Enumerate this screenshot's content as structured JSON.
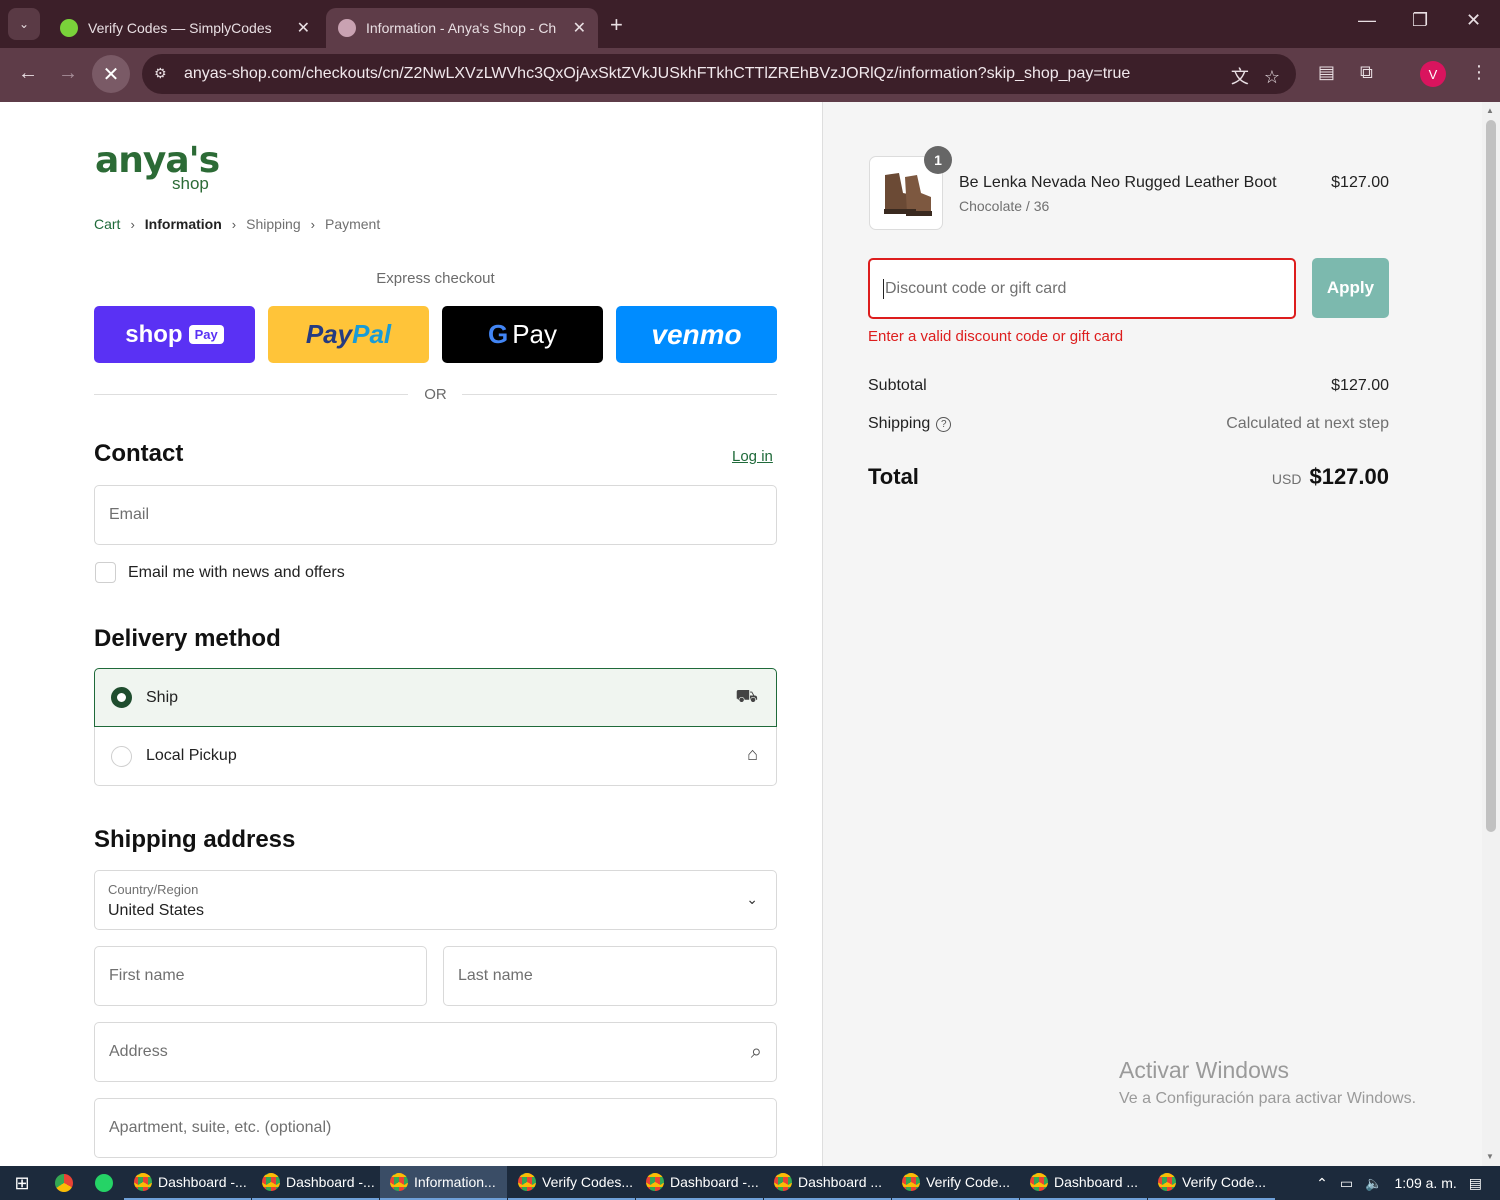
{
  "browser": {
    "tabs": [
      {
        "title": "Verify Codes — SimplyCodes",
        "favicon_color": "#7ad23a"
      },
      {
        "title": "Information - Anya's Shop - Ch",
        "favicon_color": "#c9a2b2"
      }
    ],
    "url": "anyas-shop.com/checkouts/cn/Z2NwLXVzLWVhc3QxOjAxSktZVkJUSkhFTkhCTTlZREhBVzJORlQz/information?skip_shop_pay=true",
    "avatar_letter": "V",
    "theme_color": "#5e3c48"
  },
  "shop": {
    "logo_main": "anya's",
    "logo_sub": "shop",
    "brand_color": "#2c6b36"
  },
  "breadcrumb": [
    "Cart",
    "Information",
    "Shipping",
    "Payment"
  ],
  "express": {
    "label": "Express checkout",
    "shop_pay": "shop",
    "shop_pay_pill": "Pay",
    "paypal_a": "Pay",
    "paypal_b": "Pal",
    "gpay_g": "G",
    "gpay": "Pay",
    "venmo": "venmo",
    "or": "OR"
  },
  "contact": {
    "heading": "Contact",
    "login": "Log in",
    "email_placeholder": "Email",
    "newsletter": "Email me with news and offers"
  },
  "delivery": {
    "heading": "Delivery method",
    "options": [
      {
        "label": "Ship",
        "selected": true
      },
      {
        "label": "Local Pickup",
        "selected": false
      }
    ]
  },
  "shipping": {
    "heading": "Shipping address",
    "country_label": "Country/Region",
    "country": "United States",
    "first_name": "First name",
    "last_name": "Last name",
    "address": "Address",
    "apartment": "Apartment, suite, etc. (optional)"
  },
  "summary": {
    "product": {
      "name": "Be Lenka Nevada Neo Rugged Leather Boot",
      "variant": "Chocolate / 36",
      "price": "$127.00",
      "quantity": "1"
    },
    "discount_placeholder": "Discount code or gift card",
    "apply": "Apply",
    "error": "Enter a valid discount code or gift card",
    "subtotal_label": "Subtotal",
    "subtotal": "$127.00",
    "shipping_label": "Shipping",
    "shipping_value": "Calculated at next step",
    "total_label": "Total",
    "currency": "USD",
    "total": "$127.00"
  },
  "watermark": {
    "line1": "Activar Windows",
    "line2": "Ve a Configuración para activar Windows."
  },
  "taskbar": {
    "items": [
      {
        "label": "Dashboard -...",
        "active": false
      },
      {
        "label": "Dashboard -...",
        "active": false
      },
      {
        "label": "Information...",
        "active": true
      },
      {
        "label": "Verify Codes...",
        "active": false
      },
      {
        "label": "Dashboard -...",
        "active": false
      },
      {
        "label": "Dashboard ...",
        "active": false
      },
      {
        "label": "Verify Code...",
        "active": false
      },
      {
        "label": "Dashboard ...",
        "active": false
      },
      {
        "label": "Verify Code...",
        "active": false
      }
    ],
    "time": "1:09 a. m."
  }
}
